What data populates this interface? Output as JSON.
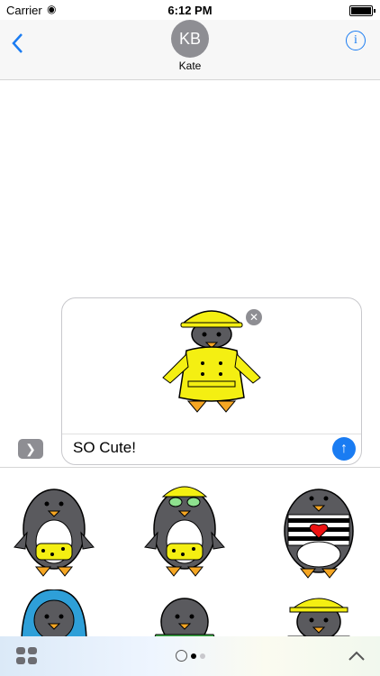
{
  "status": {
    "carrier": "Carrier",
    "time": "6:12 PM"
  },
  "header": {
    "avatar_initials": "KB",
    "contact_name": "Kate",
    "info_label": "i"
  },
  "compose": {
    "message_text": "SO Cute!"
  },
  "drawer": {
    "stickers": [
      {
        "name": "penguin-bikini",
        "accessory": "none"
      },
      {
        "name": "penguin-bikini-goggles",
        "accessory": "cap"
      },
      {
        "name": "penguin-striped-heart",
        "accessory": "none"
      },
      {
        "name": "penguin-blue-hood",
        "accessory": "hood"
      },
      {
        "name": "penguin-green-coat",
        "accessory": "none"
      },
      {
        "name": "penguin-yellow-raincoat",
        "accessory": "rainhat"
      }
    ]
  },
  "colors": {
    "accent": "#1a7cf2",
    "raincoat": "#f4ef12",
    "penguin": "#5a5a5e",
    "beak": "#f5a623"
  }
}
